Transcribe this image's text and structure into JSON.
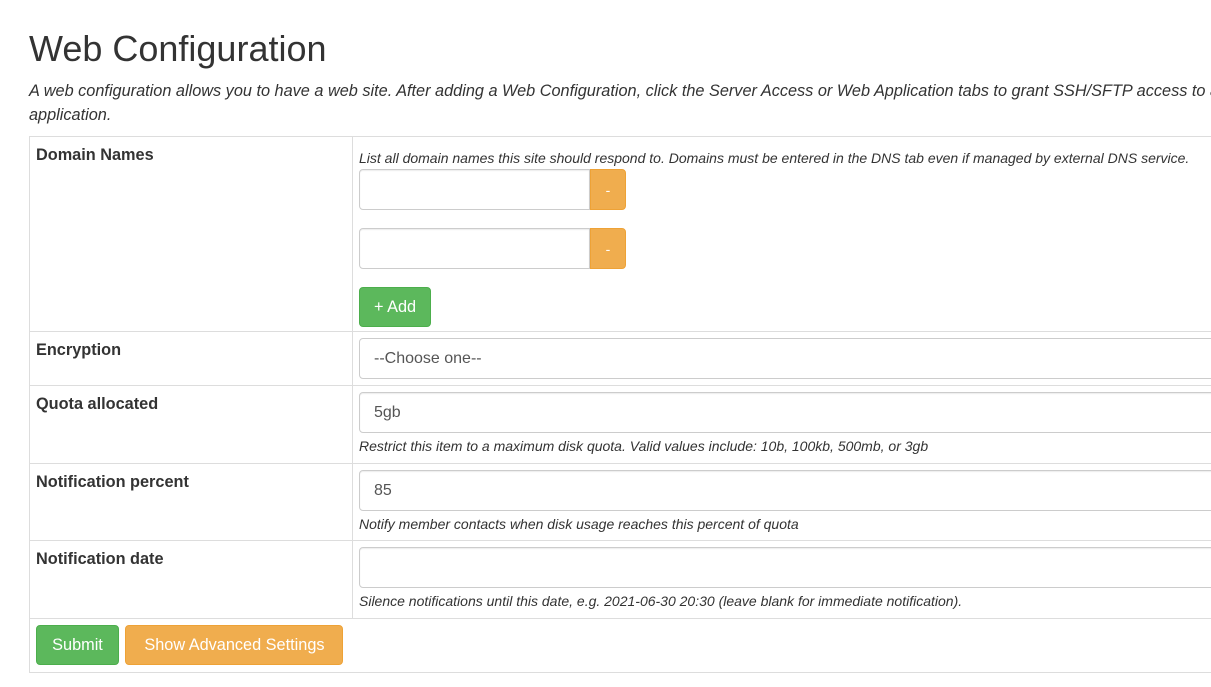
{
  "page": {
    "title": "Web Configuration",
    "intro": "A web configuration allows you to have a web site. After adding a Web Configuration, click the Server Access or Web Application tabs to grant SSH/SFTP access to another application."
  },
  "form": {
    "domain_names": {
      "label": "Domain Names",
      "help": "List all domain names this site should respond to. Domains must be entered in the DNS tab even if managed by external DNS service.",
      "entries": [
        {
          "value": "",
          "remove_label": "-"
        },
        {
          "value": "",
          "remove_label": "-"
        }
      ],
      "add_label": "+ Add"
    },
    "encryption": {
      "label": "Encryption",
      "selected": "--Choose one--"
    },
    "quota": {
      "label": "Quota allocated",
      "value": "5gb",
      "help": "Restrict this item to a maximum disk quota. Valid values include: 10b, 100kb, 500mb, or 3gb"
    },
    "notification_percent": {
      "label": "Notification percent",
      "value": "85",
      "help": "Notify member contacts when disk usage reaches this percent of quota"
    },
    "notification_date": {
      "label": "Notification date",
      "value": "",
      "help": "Silence notifications until this date, e.g. 2021-06-30 20:30 (leave blank for immediate notification)."
    },
    "actions": {
      "submit_label": "Submit",
      "advanced_label": "Show Advanced Settings"
    }
  },
  "colors": {
    "success": "#5cb85c",
    "warning": "#f0ad4e",
    "border": "#dddddd"
  }
}
